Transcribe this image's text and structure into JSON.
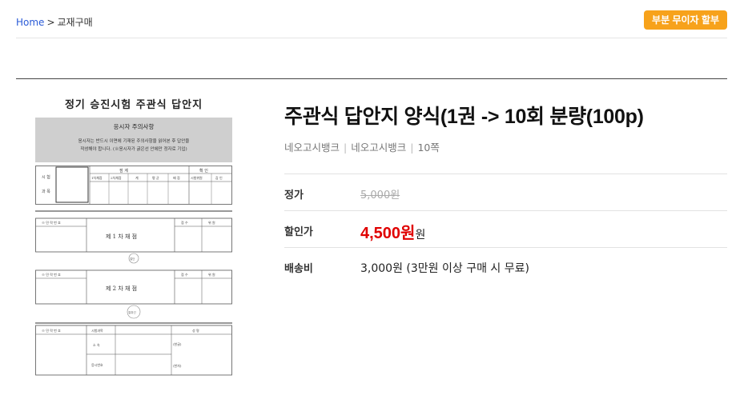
{
  "breadcrumb": {
    "home": "Home",
    "separator": ">",
    "current": "교재구매"
  },
  "promo_button": "부분 무이자 할부",
  "product": {
    "title": "주관식 답안지 양식(1권 -> 10회 분량(100p)",
    "publisher": "네오고시뱅크",
    "brand": "네오고시뱅크",
    "pages": "10쪽",
    "rows": {
      "list_price_label": "정가",
      "list_price": "5,000원",
      "sale_label": "할인가",
      "sale_price": "4,500원",
      "sale_unit": "원",
      "shipping_label": "배송비",
      "shipping": "3,000원 (3만원 이상 구매 시 무료)"
    }
  },
  "sheet": {
    "title": "정기 승진시험 주관식 답안지",
    "notice_title": "응시자 주의사항",
    "notice_line1": "응시자는 반드시 이면에 기재된 주의사항을 읽어본 후 답안을",
    "notice_line2": "작성해야 합니다. (※응시자가 굵은선 안에만 정자로 기입)",
    "applicant_label_1": "시 험",
    "applicant_label_2": "과 목",
    "score_header": "점                  계",
    "confirm_header": "확    인",
    "score_cols": [
      "1차채점",
      "2차채점",
      "계",
      "평 균",
      "배 점",
      "시험위원",
      "감 인"
    ],
    "exam_no": "※ 민 락 번 호",
    "grader1": "제 1 차 채 점",
    "grader2": "제 2 차 채 점",
    "score": "점  수",
    "seal": "위  원",
    "round1_mark": "절단",
    "round2_mark": "절취선",
    "bottom_exam_no": "※ 민 락 번 호",
    "bottom_rows": [
      "시험과목",
      "소  속",
      "응시번호"
    ],
    "name_header": "성          명",
    "hangul": "(한글)",
    "hanja": "(한자)"
  },
  "colors": {
    "link": "#2a5bd7",
    "promo": "#f7a21b",
    "sale": "#e00000"
  }
}
